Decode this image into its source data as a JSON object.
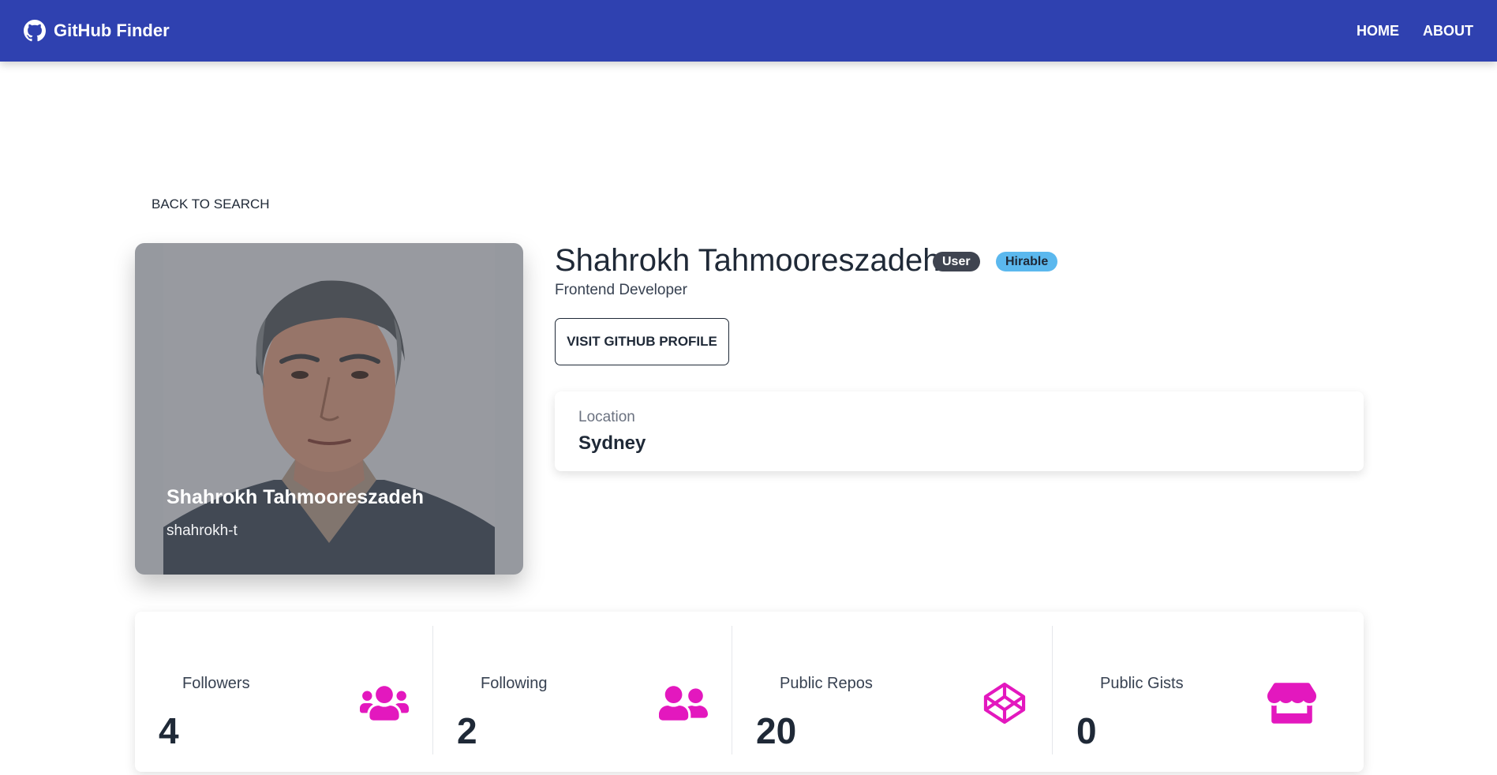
{
  "navbar": {
    "brand": "GitHub Finder",
    "links": [
      "HOME",
      "ABOUT"
    ]
  },
  "back_label": "BACK TO SEARCH",
  "avatar_card": {
    "name": "Shahrokh Tahmooreszadeh",
    "login": "shahrokh-t"
  },
  "profile": {
    "name": "Shahrokh Tahmooreszadeh",
    "badge_type": "User",
    "badge_hirable": "Hirable",
    "bio": "Frontend Developer",
    "visit_label": "VISIT GITHUB PROFILE"
  },
  "location": {
    "label": "Location",
    "value": "Sydney"
  },
  "stats": [
    {
      "title": "Followers",
      "value": "4",
      "icon": "users-icon"
    },
    {
      "title": "Following",
      "value": "2",
      "icon": "user-friends-icon"
    },
    {
      "title": "Public Repos",
      "value": "20",
      "icon": "codepen-icon"
    },
    {
      "title": "Public Gists",
      "value": "0",
      "icon": "store-icon"
    }
  ],
  "colors": {
    "navbar": "#2f41b0",
    "accent": "#e318be",
    "badge_user": "#3f4450",
    "badge_hirable": "#5bb8ee"
  }
}
